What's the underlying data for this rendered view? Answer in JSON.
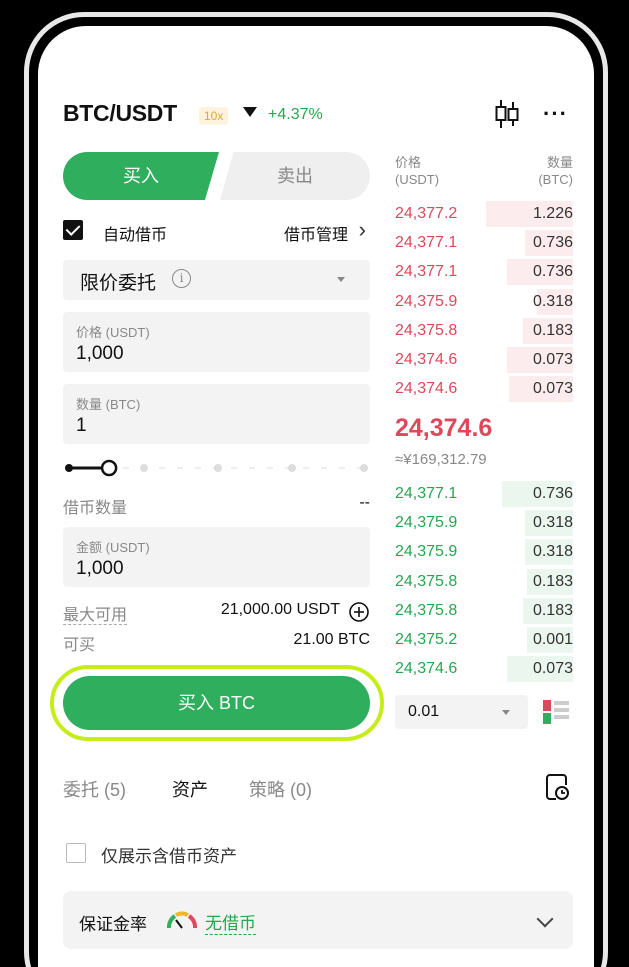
{
  "header": {
    "pair": "BTC/USDT",
    "leverage": "10x",
    "change": "+4.37%"
  },
  "trade_tabs": {
    "buy": "买入",
    "sell": "卖出"
  },
  "auto_borrow": {
    "label": "自动借币",
    "manage": "借币管理",
    "manage_arrow": "›"
  },
  "order_type": {
    "label": "限价委托",
    "info": "i"
  },
  "price_field": {
    "label": "价格 (USDT)",
    "value": "1,000"
  },
  "amount_field": {
    "label": "数量 (BTC)",
    "value": "1"
  },
  "slider": {
    "level": 0.15
  },
  "borrow_amount": {
    "label": "借币数量",
    "value": "--"
  },
  "total_field": {
    "label": "金额 (USDT)",
    "value": "1,000"
  },
  "max_available": {
    "label": "最大可用",
    "value": "21,000.00 USDT"
  },
  "can_buy": {
    "label": "可买",
    "value": "21.00 BTC"
  },
  "buy_button": {
    "label": "买入 BTC"
  },
  "orderbook": {
    "price_header": [
      "价格",
      "(USDT)"
    ],
    "qty_header": [
      "数量",
      "(BTC)"
    ],
    "asks": [
      {
        "price": "24,377.2",
        "qty": "1.226",
        "depth": 0.49
      },
      {
        "price": "24,377.1",
        "qty": "0.736",
        "depth": 0.27
      },
      {
        "price": "24,377.1",
        "qty": "0.736",
        "depth": 0.37
      },
      {
        "price": "24,375.9",
        "qty": "0.318",
        "depth": 0.2
      },
      {
        "price": "24,375.8",
        "qty": "0.183",
        "depth": 0.28
      },
      {
        "price": "24,374.6",
        "qty": "0.073",
        "depth": 0.37
      },
      {
        "price": "24,374.6",
        "qty": "0.073",
        "depth": 0.36
      }
    ],
    "mid_price": "24,374.6",
    "mid_cny": "≈¥169,312.79",
    "bids": [
      {
        "price": "24,377.1",
        "qty": "0.736",
        "depth": 0.4
      },
      {
        "price": "24,375.9",
        "qty": "0.318",
        "depth": 0.27
      },
      {
        "price": "24,375.9",
        "qty": "0.318",
        "depth": 0.27
      },
      {
        "price": "24,375.8",
        "qty": "0.183",
        "depth": 0.26
      },
      {
        "price": "24,375.8",
        "qty": "0.183",
        "depth": 0.28
      },
      {
        "price": "24,375.2",
        "qty": "0.001",
        "depth": 0.26
      },
      {
        "price": "24,374.6",
        "qty": "0.073",
        "depth": 0.37
      }
    ],
    "precision": "0.01"
  },
  "bottom_tabs": [
    {
      "label": "委托 (5)"
    },
    {
      "label": "资产"
    },
    {
      "label": "策略 (0)"
    }
  ],
  "show_borrow_only": {
    "label": "仅展示含借币资产"
  },
  "margin_ratio": {
    "label": "保证金率",
    "status": "无借币"
  },
  "colors": {
    "buy_green": "#2fae5e",
    "ask_red": "#e0475a",
    "highlight": "#c6ec1a",
    "leverage_gold": "#d8a83a"
  }
}
